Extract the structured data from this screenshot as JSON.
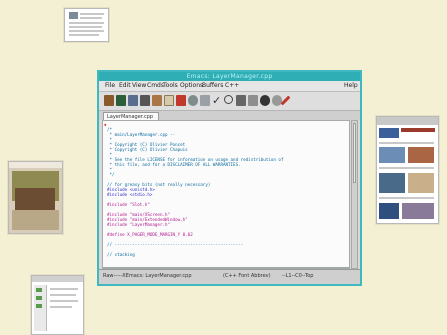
{
  "window": {
    "title": "Emacs: LayerManager.cpp",
    "menu": [
      "File",
      "Edit",
      "View",
      "Cmds",
      "Tools",
      "Options",
      "Buffers",
      "C++",
      "Help"
    ],
    "toolbar_icons": [
      "open-icon",
      "dired-icon",
      "save-icon",
      "print-icon",
      "cut-icon",
      "copy-icon",
      "paste-icon",
      "undo-icon",
      "spell-icon",
      "search-icon",
      "replace-icon",
      "info-icon",
      "compile-icon",
      "debug-icon",
      "news-icon",
      "mail-icon"
    ]
  },
  "tab": {
    "label": "LayerManager.cpp"
  },
  "code": {
    "lines": [
      {
        "text": "/*",
        "cls": "cm"
      },
      {
        "text": " * main/LayerManager.cpp --",
        "cls": "cm"
      },
      {
        "text": " *",
        "cls": "cm"
      },
      {
        "text": " * Copyright (C) Olivier Poncet",
        "cls": "cm"
      },
      {
        "text": " * Copyright (C) Olivier Chapuis",
        "cls": "cm"
      },
      {
        "text": " *",
        "cls": "cm"
      },
      {
        "text": " * See the file LICENSE for information on usage and redistribution of",
        "cls": "cm"
      },
      {
        "text": " * this file, and for a DISCLAIMER OF ALL WARRANTIES.",
        "cls": "cm"
      },
      {
        "text": " *",
        "cls": "cm"
      },
      {
        "text": " */",
        "cls": "cm"
      },
      {
        "text": "",
        "cls": "cm"
      },
      {
        "text": "// for greasy bits (not really necessary)",
        "cls": "cm"
      },
      {
        "text": "#include <unistd.h>",
        "cls": "pp"
      },
      {
        "text": "#include <stdio.h>",
        "cls": "pp"
      },
      {
        "text": "",
        "cls": "pp"
      },
      {
        "text": "#include \"Slot.h\"",
        "cls": "str"
      },
      {
        "text": "",
        "cls": "pp"
      },
      {
        "text": "#include \"main/XScreen.h\"",
        "cls": "str"
      },
      {
        "text": "#include \"main/ExtendedWindow.h\"",
        "cls": "str"
      },
      {
        "text": "#include \"LayerManager.h\"",
        "cls": "str"
      },
      {
        "text": "",
        "cls": "pp"
      },
      {
        "text": "#define X_PAGER_MODE_MARGIN_Y 0.02",
        "cls": "str"
      },
      {
        "text": "",
        "cls": "pp"
      },
      {
        "text": "// ---------------------------------------------------",
        "cls": "cm"
      },
      {
        "text": "",
        "cls": "cm"
      },
      {
        "text": "// stacking",
        "cls": "cm"
      }
    ]
  },
  "status": {
    "left": "Raw-----XEmacs: LayerManager.cpp",
    "mode": "(C++ Font Abbrev)",
    "position": "--L1--C0--Top"
  },
  "colors": {
    "title_bar": "#2faeb6",
    "frame": "#3fb8bf",
    "desktop": "#f3f0d4"
  }
}
